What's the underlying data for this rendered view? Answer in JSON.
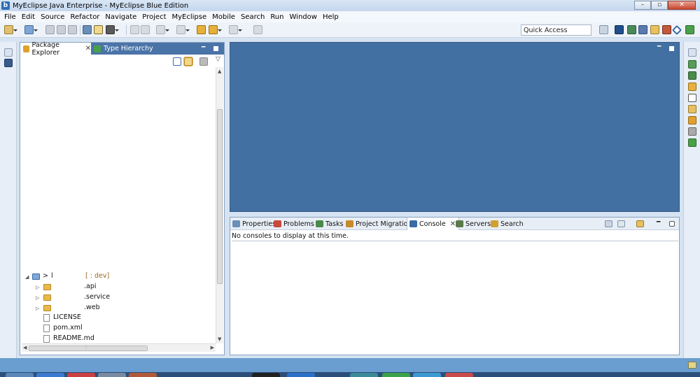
{
  "window": {
    "title": "MyEclipse Java Enterprise - MyEclipse Blue Edition",
    "logo_letter": "b",
    "minimize_glyph": "–",
    "maximize_glyph": "▫",
    "close_glyph": "✕"
  },
  "menubar": {
    "items": [
      "File",
      "Edit",
      "Source",
      "Refactor",
      "Navigate",
      "Project",
      "MyEclipse",
      "Mobile",
      "Search",
      "Run",
      "Window",
      "Help"
    ]
  },
  "toolbar": {
    "quick_access_value": "Quick Access",
    "icons": [
      "new-icon",
      "save-icon",
      "save-all-icon",
      "print-icon",
      "open-type-icon",
      "build-icon",
      "run-icon",
      "back-icon",
      "forward-icon",
      "pin-icon"
    ],
    "perspective_icons": [
      "open-perspective-icon",
      "myeclipse-perspective-icon",
      "debug-perspective-icon",
      "java-perspective-icon",
      "team-perspective-icon",
      "git-perspective-icon",
      "other-perspective-icon",
      "plugin-perspective-icon"
    ]
  },
  "package_explorer": {
    "tab_active_label": "Package Explorer",
    "tab_close_glyph": "✕",
    "tab_other_label": "Type Hierarchy",
    "view_menu_glyph": "▽",
    "hscroll_thumb_glyph": "⦙",
    "tree": [
      {
        "name": "project-root",
        "twisty": "◢",
        "prefix": "> ",
        "label": "l",
        "suffix": "[             : dev]",
        "kind": "project"
      },
      {
        "name": "module-api",
        "twisty": "▷",
        "label": ".api",
        "kind": "folder"
      },
      {
        "name": "module-service",
        "twisty": "▷",
        "label": ".service",
        "kind": "folder"
      },
      {
        "name": "module-web",
        "twisty": "▷",
        "label": ".web",
        "kind": "folder"
      },
      {
        "name": "file-license",
        "twisty": "",
        "label": "LICENSE",
        "kind": "file"
      },
      {
        "name": "file-pom",
        "twisty": "",
        "label": "pom.xml",
        "kind": "file"
      },
      {
        "name": "file-readme",
        "twisty": "",
        "label": "README.md",
        "kind": "file"
      }
    ]
  },
  "console_view": {
    "tabs": [
      {
        "label": "Properties",
        "icon": "properties-icon",
        "color": "#6a8fb8"
      },
      {
        "label": "Problems",
        "icon": "problems-icon",
        "color": "#c94a3a"
      },
      {
        "label": "Tasks",
        "icon": "tasks-icon",
        "color": "#4a8a4a"
      },
      {
        "label": "Project Migration",
        "icon": "migration-icon",
        "color": "#c98a2a"
      },
      {
        "label": "Console",
        "icon": "console-icon",
        "color": "#3a6aa8"
      },
      {
        "label": "Servers",
        "icon": "servers-icon",
        "color": "#5a7a4a"
      },
      {
        "label": "Search",
        "icon": "search-icon",
        "color": "#d0a030"
      }
    ],
    "close_glyph": "✕",
    "message": "No consoles to display at this time."
  },
  "colors": {
    "editor_bg": "#4370a2",
    "tab_strip": "#4a74a8",
    "status_bar": "#6a9dd0"
  }
}
